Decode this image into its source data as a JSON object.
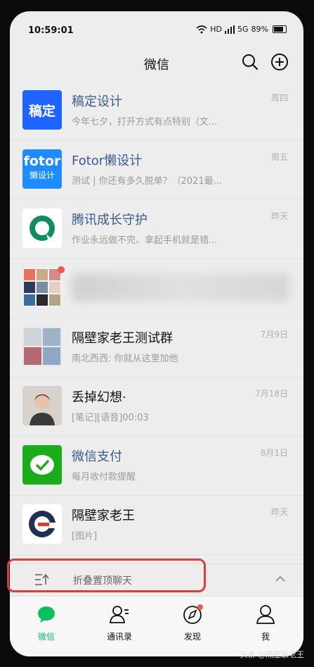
{
  "status_bar": {
    "time": "10:59:01",
    "hd": "HD",
    "signal": "5G",
    "battery": "89%"
  },
  "header": {
    "title": "微信"
  },
  "chats": [
    {
      "name": "稿定设计",
      "message": "今年七夕，打开方式有点特别（文...",
      "time": "周四",
      "avatar_text": "稿定",
      "avatar_color": "#1e63ff"
    },
    {
      "name": "Fotor懒设计",
      "message": "测试 | 你还有多久脱单？（2021最...",
      "time": "周五",
      "avatar_text": "fotor",
      "avatar_subtext": "懒设计",
      "avatar_color": "#1e8cff"
    },
    {
      "name": "腾讯成长守护",
      "message": "作业永远做不完、拿起手机就是错...",
      "time": "昨天",
      "avatar_color": "#0e8c5b"
    },
    {
      "name": "",
      "message": "",
      "time": ""
    },
    {
      "name": "隔壁家老王测试群",
      "message": "南北西西: 你就从这里加他",
      "time": "7月9日"
    },
    {
      "name": "丢掉幻想·",
      "message": "[笔记][语音]00:03",
      "time": "7月18日"
    },
    {
      "name": "微信支付",
      "message": "每月收付款提醒",
      "time": "8月1日",
      "avatar_color": "#1aad19"
    },
    {
      "name": "隔壁家老王",
      "message": "[图片]",
      "time": "昨天"
    }
  ],
  "fold": {
    "label": "折叠置顶聊天"
  },
  "tabs": [
    {
      "label": "微信"
    },
    {
      "label": "通讯录"
    },
    {
      "label": "发现"
    },
    {
      "label": "我"
    }
  ],
  "watermark": "头条 @隔壁家老王",
  "colors": {
    "accent": "#07c160",
    "highlight": "#e23b3b"
  }
}
